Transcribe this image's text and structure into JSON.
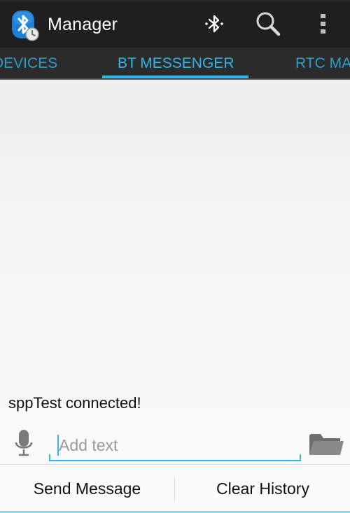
{
  "action_bar": {
    "title": "Manager",
    "icons": {
      "app": "bluetooth-clock-app-icon",
      "bluetooth": "bluetooth-icon",
      "search": "search-icon",
      "overflow": "overflow-menu-icon"
    }
  },
  "tabs": [
    {
      "label": "DEVICES",
      "selected": false
    },
    {
      "label": "BT MESSENGER",
      "selected": true
    },
    {
      "label": "RTC MA",
      "selected": false
    }
  ],
  "messages": {
    "status": "sppTest connected!"
  },
  "input": {
    "placeholder": "Add text",
    "value": "",
    "mic_icon": "microphone-icon",
    "folder_icon": "folder-icon"
  },
  "buttons": {
    "send_label": "Send Message",
    "clear_label": "Clear History"
  },
  "colors": {
    "accent": "#33b5e5",
    "action_bar_bg": "#1f1f1f",
    "tab_strip_bg": "#2b2b2b",
    "app_icon_blue": "#1e7fd6"
  }
}
